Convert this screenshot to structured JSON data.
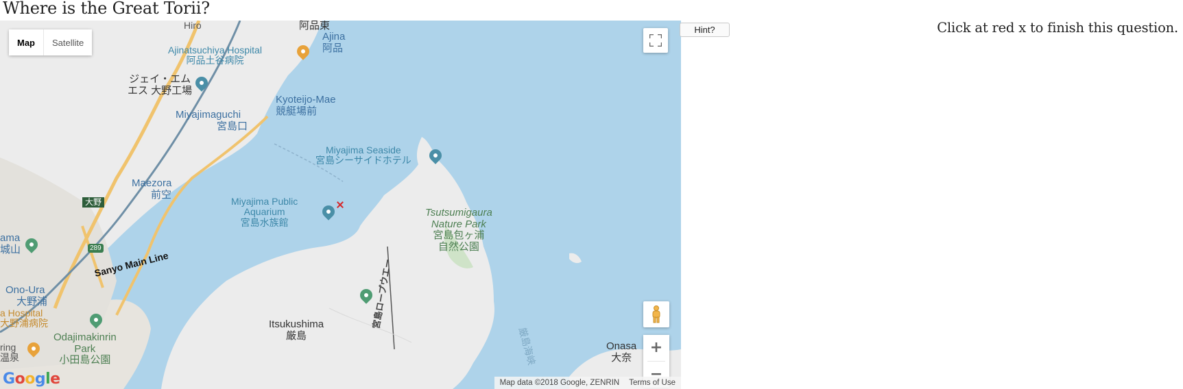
{
  "question": "Where is the Great Torii?",
  "hint_button": "Hint?",
  "instruction": "Click at red x to finish this question.",
  "map": {
    "type_controls": {
      "map": "Map",
      "satellite": "Satellite",
      "selected": "Map"
    },
    "zoom": {
      "in": "+",
      "out": "−"
    },
    "attribution": {
      "data": "Map data ©2018 Google, ZENRIN",
      "terms": "Terms of Use"
    },
    "logo": "Google",
    "labels": {
      "hiroshima": "Hiro",
      "ajina_top": "阿品東",
      "ajina": "Ajina",
      "ajina_jp": "阿品",
      "ajinatsuchiya": "Ajinatsuchiya Hospital",
      "ajinatsuchiya_jp": "阿品土谷病院",
      "jm_factory1": "ジェイ・エム",
      "jm_factory2": "エス 大野工場",
      "kyoteijo": "Kyoteijo-Mae",
      "kyoteijo_jp": "競艇場前",
      "miyajimaguchi": "Miyajimaguchi",
      "miyajimaguchi_jp": "宮島口",
      "seaside": "Miyajima Seaside",
      "seaside_jp": "宮島シーサイドホテル",
      "maezora": "Maezora",
      "maezora_jp": "前空",
      "ono_sign": "大野",
      "aquarium": "Miyajima Public",
      "aquarium2": "Aquarium",
      "aquarium_jp": "宮島水族館",
      "park": "Tsutsumigaura",
      "park2": "Nature Park",
      "park_jp": "宮島包ヶ浦",
      "park_jp2": "自然公園",
      "castle": "ama",
      "castle_jp": "城山",
      "route": "289",
      "sanyo": "Sanyo Main Line",
      "ono_ura": "Ono-Ura",
      "ono_ura_jp": "大野浦",
      "hospital": "a Hospital",
      "hospital_jp": "大野浦病院",
      "odajima": "Odajimakinrin",
      "odajima2": "Park",
      "odajima_jp": "小田島公園",
      "ring": "ring",
      "onsen_jp": "温泉",
      "itsukushima": "Itsukushima",
      "itsukushima_jp": "厳島",
      "ropeway": "宮島ロープウエー",
      "channel": "厳島海峡",
      "onasa": "Onasa",
      "onasa_jp": "大奈"
    }
  }
}
